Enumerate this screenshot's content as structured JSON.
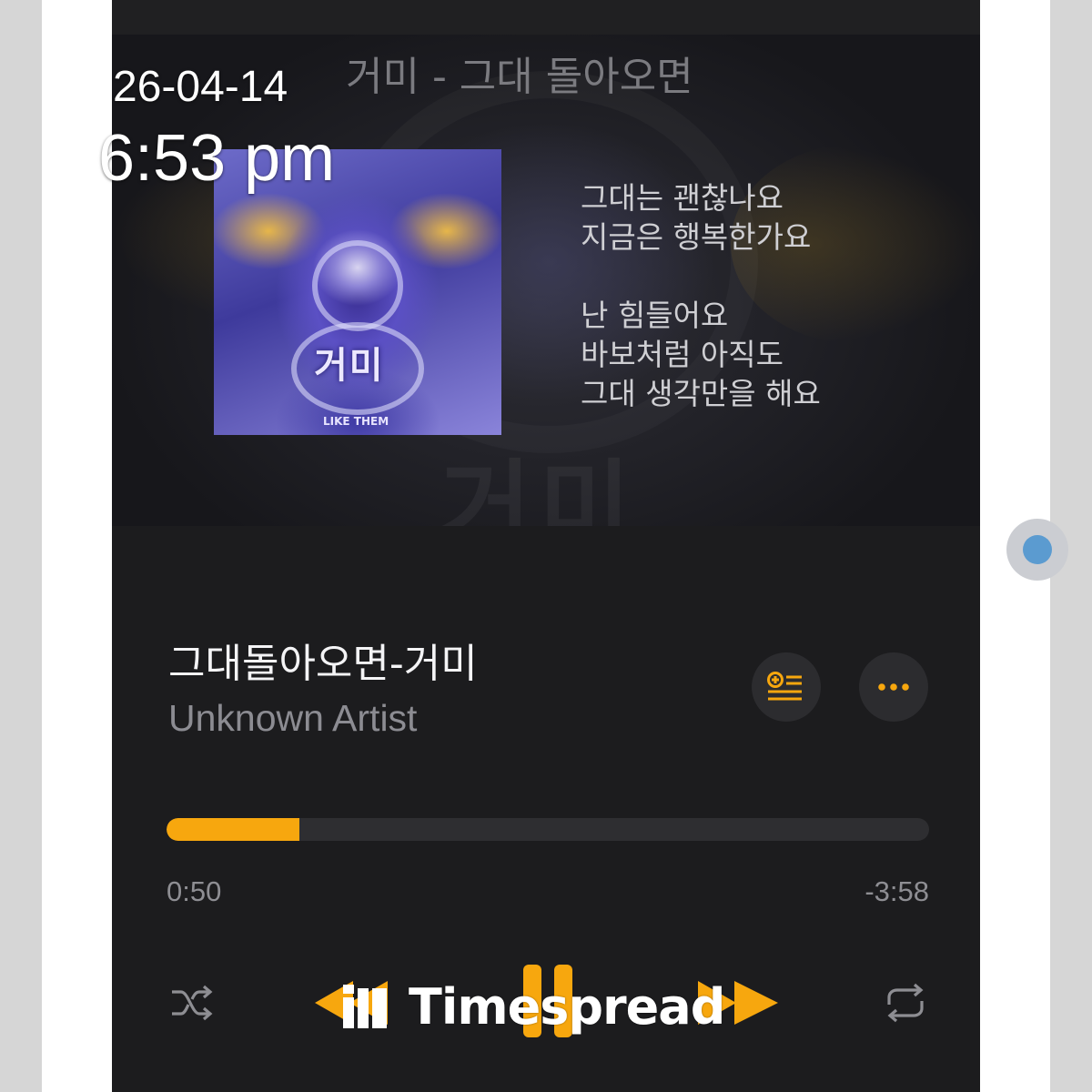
{
  "overlay": {
    "date": "26-04-14",
    "time": "6:53 pm"
  },
  "header": {
    "title": "거미 - 그대 돌아오면"
  },
  "album": {
    "logo_text": "거미",
    "subtitle": "LIKE THEM"
  },
  "lyrics": {
    "verse1": [
      "그대는 괜찮나요",
      "지금은 행복한가요"
    ],
    "verse2": [
      "난 힘들어요",
      "바보처럼 아직도",
      "그대 생각만을 해요"
    ]
  },
  "song": {
    "title": "그대돌아오면-거미",
    "artist": "Unknown Artist"
  },
  "playback": {
    "elapsed": "0:50",
    "remaining": "-3:58",
    "progress_fraction": 0.174,
    "state": "playing"
  },
  "icons": {
    "add_to_queue": "add-to-queue-icon",
    "more": "more-icon",
    "shuffle": "shuffle-icon",
    "previous": "previous-icon",
    "pause": "pause-icon",
    "next": "next-icon",
    "repeat": "repeat-icon"
  },
  "watermark": {
    "text": "Timespread"
  },
  "colors": {
    "accent": "#f7a70e",
    "background": "#1c1c1e",
    "secondary_text": "#8c8c92"
  }
}
